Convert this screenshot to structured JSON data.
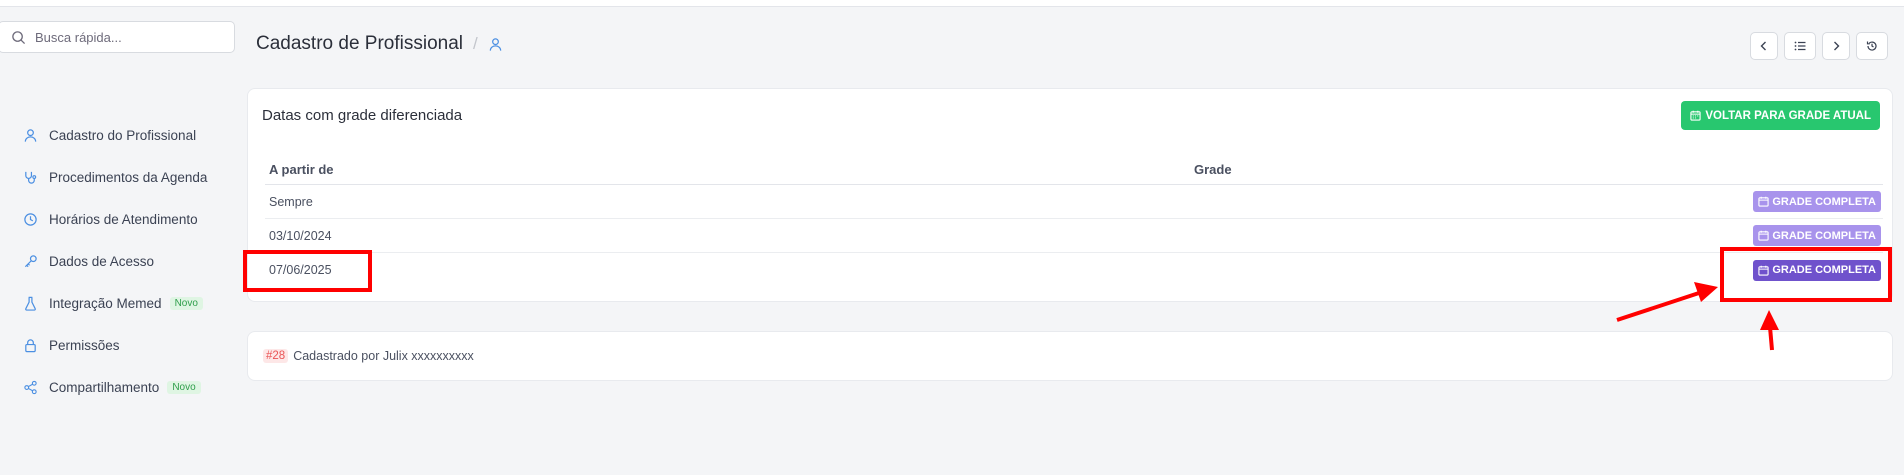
{
  "search": {
    "placeholder": "Busca rápida..."
  },
  "sidebar": {
    "items": [
      {
        "label": "Cadastro do Profissional",
        "icon": "user-icon",
        "badge": ""
      },
      {
        "label": "Procedimentos da Agenda",
        "icon": "stethoscope-icon",
        "badge": ""
      },
      {
        "label": "Horários de Atendimento",
        "icon": "clock-icon",
        "badge": ""
      },
      {
        "label": "Dados de Acesso",
        "icon": "key-icon",
        "badge": ""
      },
      {
        "label": "Integração Memed",
        "icon": "flask-icon",
        "badge": "Novo"
      },
      {
        "label": "Permissões",
        "icon": "lock-icon",
        "badge": ""
      },
      {
        "label": "Compartilhamento",
        "icon": "share-icon",
        "badge": "Novo"
      }
    ]
  },
  "header": {
    "title": "Cadastro de Profissional",
    "separator": "/",
    "actions": [
      "previous-icon",
      "list-icon",
      "next-icon",
      "history-icon"
    ]
  },
  "card": {
    "title": "Datas com grade diferenciada",
    "voltar_label": "VOLTAR PARA GRADE ATUAL",
    "columns": [
      "A partir de",
      "Grade"
    ],
    "rows": [
      {
        "date": "Sempre",
        "button": "GRADE COMPLETA"
      },
      {
        "date": "03/10/2024",
        "button": "GRADE COMPLETA"
      },
      {
        "date": "07/06/2025",
        "button": "GRADE COMPLETA"
      }
    ]
  },
  "footer": {
    "id": "#28",
    "text": "Cadastrado por Julix xxxxxxxxxx"
  },
  "colors": {
    "accent_green": "#28c76f",
    "grade_button": "#a893ec",
    "grade_button_active": "#6f52cc",
    "annotation": "#ff0000",
    "link_blue": "#4b8fe2"
  }
}
